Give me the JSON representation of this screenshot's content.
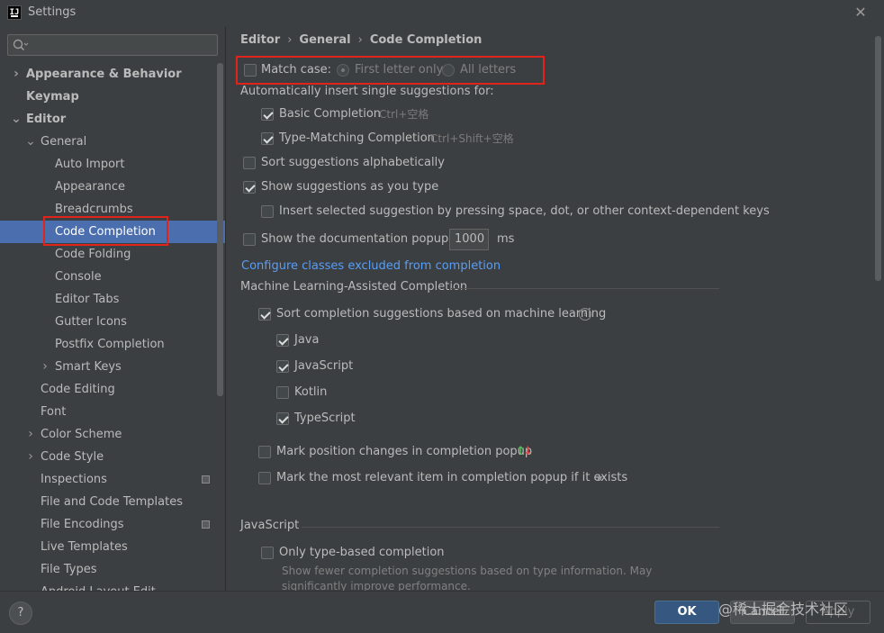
{
  "window": {
    "title": "Settings",
    "close_glyph": "✕"
  },
  "search": {
    "placeholder": ""
  },
  "tree": [
    {
      "label": "Appearance & Behavior",
      "bold": true,
      "arrow": "›"
    },
    {
      "label": "Keymap",
      "bold": true
    },
    {
      "label": "Editor",
      "bold": true,
      "arrow": "⌄"
    },
    {
      "label": "General",
      "arrow": "⌄"
    },
    {
      "label": "Auto Import"
    },
    {
      "label": "Appearance"
    },
    {
      "label": "Breadcrumbs"
    },
    {
      "label": "Code Completion",
      "selected": true
    },
    {
      "label": "Code Folding"
    },
    {
      "label": "Console"
    },
    {
      "label": "Editor Tabs"
    },
    {
      "label": "Gutter Icons"
    },
    {
      "label": "Postfix Completion"
    },
    {
      "label": "Smart Keys",
      "arrow": "›"
    },
    {
      "label": "Code Editing"
    },
    {
      "label": "Font"
    },
    {
      "label": "Color Scheme",
      "arrow": "›"
    },
    {
      "label": "Code Style",
      "arrow": "›"
    },
    {
      "label": "Inspections",
      "project_icon": true
    },
    {
      "label": "File and Code Templates"
    },
    {
      "label": "File Encodings",
      "project_icon": true
    },
    {
      "label": "Live Templates"
    },
    {
      "label": "File Types"
    },
    {
      "label": "Android Layout Edit..."
    }
  ],
  "breadcrumb": {
    "part1": "Editor",
    "part2": "General",
    "part3": "Code Completion",
    "separator": "›"
  },
  "options": {
    "match_case": {
      "label": "Match case:",
      "checked": false
    },
    "first_letter": {
      "label": "First letter only",
      "selected": true
    },
    "all_letters": {
      "label": "All letters",
      "selected": false
    },
    "auto_insert_header": "Automatically insert single suggestions for:",
    "basic_completion": {
      "label": "Basic Completion",
      "shortcut": "Ctrl+空格",
      "checked": true
    },
    "type_matching": {
      "label": "Type-Matching Completion",
      "shortcut": "Ctrl+Shift+空格",
      "checked": true
    },
    "sort_alpha": {
      "label": "Sort suggestions alphabetically",
      "checked": false
    },
    "show_as_type": {
      "label": "Show suggestions as you type",
      "checked": true
    },
    "insert_selected": {
      "label": "Insert selected suggestion by pressing space, dot, or other context-dependent keys",
      "checked": false
    },
    "doc_popup": {
      "label": "Show the documentation popup in",
      "value": "1000",
      "unit": "ms",
      "checked": false
    },
    "configure_link": "Configure classes excluded from completion",
    "ml_header": "Machine Learning-Assisted Completion",
    "ml_sort": {
      "label": "Sort completion suggestions based on machine learning",
      "checked": true,
      "help": "?"
    },
    "ml_java": {
      "label": "Java",
      "checked": true
    },
    "ml_javascript": {
      "label": "JavaScript",
      "checked": true
    },
    "ml_kotlin": {
      "label": "Kotlin",
      "checked": false
    },
    "ml_typescript": {
      "label": "TypeScript",
      "checked": true
    },
    "mark_position": {
      "label": "Mark position changes in completion popup",
      "checked": false,
      "arrow_up": "↑",
      "arrow_down": "↓"
    },
    "mark_relevant": {
      "label": "Mark the most relevant item in completion popup if it exists",
      "checked": false,
      "star": "★"
    },
    "js_header": "JavaScript",
    "type_based": {
      "label": "Only type-based completion",
      "checked": false
    },
    "type_based_desc_1": "Show fewer completion suggestions based on type information. May",
    "type_based_desc_2": "significantly improve performance."
  },
  "footer": {
    "help": "?",
    "ok": "OK",
    "cancel": "Cancel",
    "apply": "Apply",
    "watermark": "@稀土掘金技术社区"
  },
  "colors": {
    "accent": "#4b6eaf",
    "highlight_box": "#e0231b",
    "link": "#589df6",
    "ok_button": "#365880",
    "arrow_up": "#5fb65f",
    "arrow_down": "#d05050"
  }
}
